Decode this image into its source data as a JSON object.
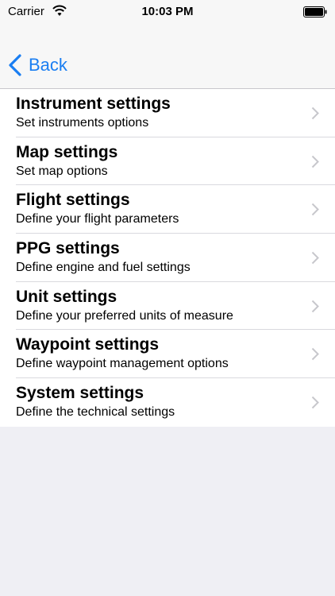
{
  "status_bar": {
    "carrier": "Carrier",
    "time": "10:03 PM"
  },
  "nav": {
    "back_label": "Back"
  },
  "colors": {
    "accent": "#1a7ef2",
    "background": "#efeff4"
  },
  "settings": [
    {
      "title": "Instrument settings",
      "subtitle": "Set instruments options"
    },
    {
      "title": "Map settings",
      "subtitle": "Set map options"
    },
    {
      "title": "Flight settings",
      "subtitle": "Define your flight parameters"
    },
    {
      "title": "PPG settings",
      "subtitle": "Define engine and fuel settings"
    },
    {
      "title": "Unit settings",
      "subtitle": "Define your preferred units of measure"
    },
    {
      "title": "Waypoint settings",
      "subtitle": "Define waypoint management options"
    },
    {
      "title": "System settings",
      "subtitle": "Define the technical settings"
    }
  ]
}
